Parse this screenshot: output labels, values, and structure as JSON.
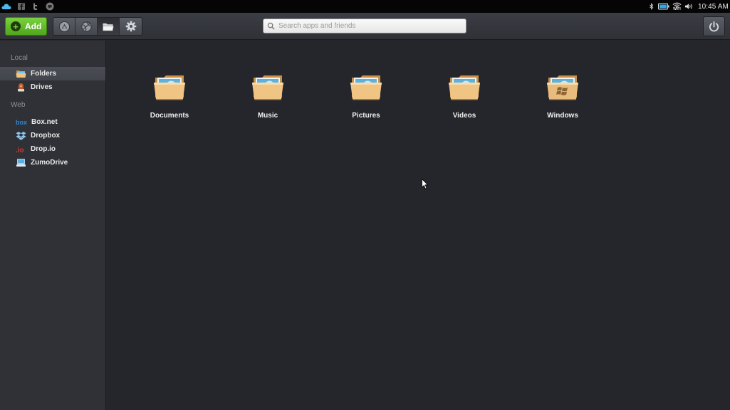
{
  "system_bar": {
    "left_icons": [
      "cloud-icon",
      "facebook-icon",
      "twitter-icon",
      "gtalk-icon"
    ],
    "right_icons": [
      "bluetooth-icon",
      "battery-icon",
      "wifi-icon",
      "volume-icon"
    ],
    "wifi_label": "WIFI",
    "clock": "10:45 AM"
  },
  "toolbar": {
    "add_label": "Add",
    "segments": [
      "apps-icon",
      "web-icon",
      "folders-icon",
      "settings-icon"
    ],
    "active_segment": "folders-icon",
    "search_placeholder": "Search apps and friends",
    "power_icon": "power-icon"
  },
  "sidebar": {
    "local_title": "Local",
    "local_items": [
      {
        "label": "Folders",
        "icon": "folder-icon",
        "selected": true
      },
      {
        "label": "Drives",
        "icon": "drive-icon",
        "selected": false
      }
    ],
    "web_title": "Web",
    "web_items": [
      {
        "label": "Box.net",
        "icon": "boxnet-icon"
      },
      {
        "label": "Dropbox",
        "icon": "dropbox-icon"
      },
      {
        "label": "Drop.io",
        "icon": "dropio-icon"
      },
      {
        "label": "ZumoDrive",
        "icon": "zumodrive-icon"
      }
    ]
  },
  "folders": [
    {
      "label": "Documents",
      "icon": "folder-icon"
    },
    {
      "label": "Music",
      "icon": "folder-icon"
    },
    {
      "label": "Pictures",
      "icon": "folder-icon"
    },
    {
      "label": "Videos",
      "icon": "folder-icon"
    },
    {
      "label": "Windows",
      "icon": "windows-folder-icon"
    }
  ],
  "colors": {
    "add_green": "#5cb82a",
    "background": "#25262b",
    "sidebar": "#2f3137",
    "folder_tan": "#e9b574"
  }
}
